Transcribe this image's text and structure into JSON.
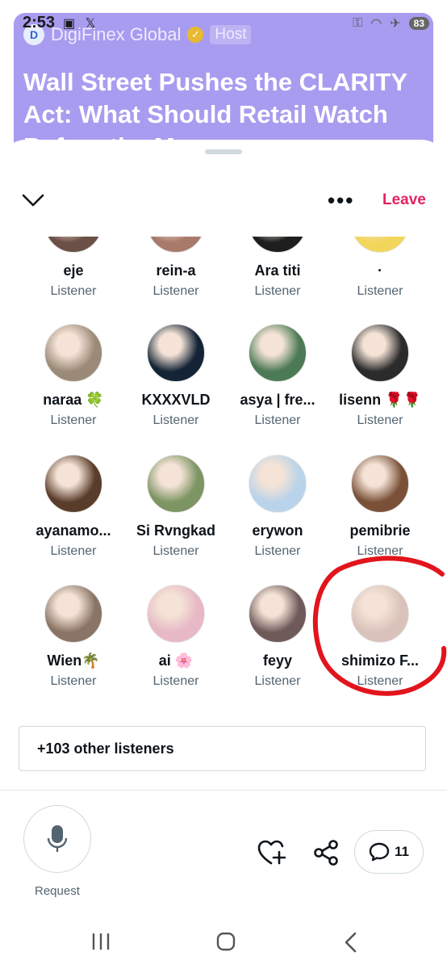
{
  "statusbar": {
    "time": "2:53",
    "battery": "83"
  },
  "space": {
    "host_name": "DigiFinex Global",
    "host_badge": "Host",
    "title": "Wall Street Pushes the CLARITY Act: What Should Retail Watch Before the M..."
  },
  "header": {
    "leave_label": "Leave"
  },
  "participants": [
    {
      "name": "eje",
      "role": "Listener",
      "color": "#6b5048"
    },
    {
      "name": "rein-a",
      "role": "Listener",
      "color": "#a87a6a"
    },
    {
      "name": "Ara titi",
      "role": "Listener",
      "color": "#1e1e1e"
    },
    {
      "name": "·",
      "role": "Listener",
      "color": "#f2d65c"
    },
    {
      "name": "naraa 🍀",
      "role": "Listener",
      "color": "#9b8a77"
    },
    {
      "name": "KXXXVLD",
      "role": "Listener",
      "color": "#142436"
    },
    {
      "name": "asya | fre...",
      "role": "Listener",
      "color": "#4c7a55"
    },
    {
      "name": "lisenn 🌹🌹",
      "role": "Listener",
      "color": "#2b2b2b"
    },
    {
      "name": "ayanamo...",
      "role": "Listener",
      "color": "#5a3c2a"
    },
    {
      "name": "Si Rvngkad",
      "role": "Listener",
      "color": "#7d9463"
    },
    {
      "name": "erywon",
      "role": "Listener",
      "color": "#b9d3ea"
    },
    {
      "name": "pemibrie",
      "role": "Listener",
      "color": "#7a5138"
    },
    {
      "name": "Wien🌴",
      "role": "Listener",
      "color": "#8a7465"
    },
    {
      "name": "ai 🌸",
      "role": "Listener",
      "color": "#e7b8c6"
    },
    {
      "name": "feyy",
      "role": "Listener",
      "color": "#6f5a5a"
    },
    {
      "name": "shimizo F...",
      "role": "Listener",
      "color": "#d9c2ba"
    }
  ],
  "other_listeners": "+103 other listeners",
  "controls": {
    "request_label": "Request",
    "comment_count": "11"
  },
  "colors": {
    "leave": "#e0245e",
    "banner": "#a89cf0",
    "annotation": "#e2141c"
  }
}
